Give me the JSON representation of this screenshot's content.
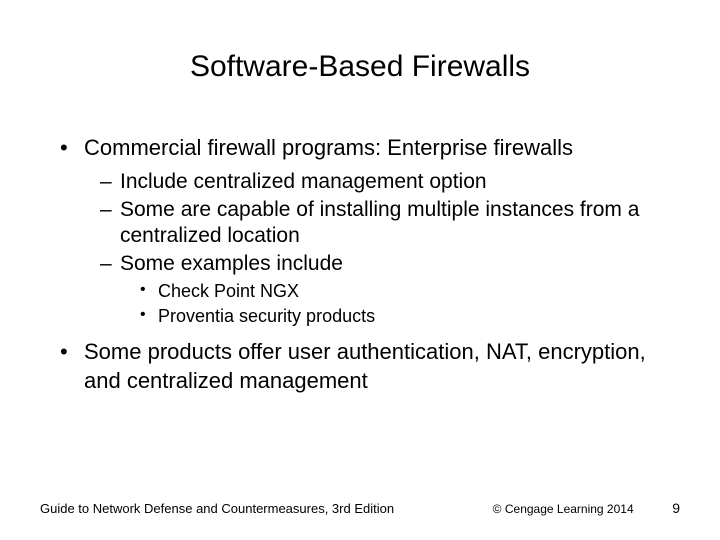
{
  "title": "Software-Based Firewalls",
  "bullets": {
    "b1": "Commercial firewall programs: Enterprise firewalls",
    "b1_1": "Include centralized management option",
    "b1_2": "Some are capable of installing multiple instances from a centralized location",
    "b1_3": "Some examples include",
    "b1_3_1": "Check Point NGX",
    "b1_3_2": "Proventia security products",
    "b2": "Some products offer user authentication, NAT, encryption, and centralized management"
  },
  "footer": {
    "left": "Guide to Network Defense and Countermeasures, 3rd Edition",
    "center": "© Cengage Learning  2014",
    "right": "9"
  }
}
